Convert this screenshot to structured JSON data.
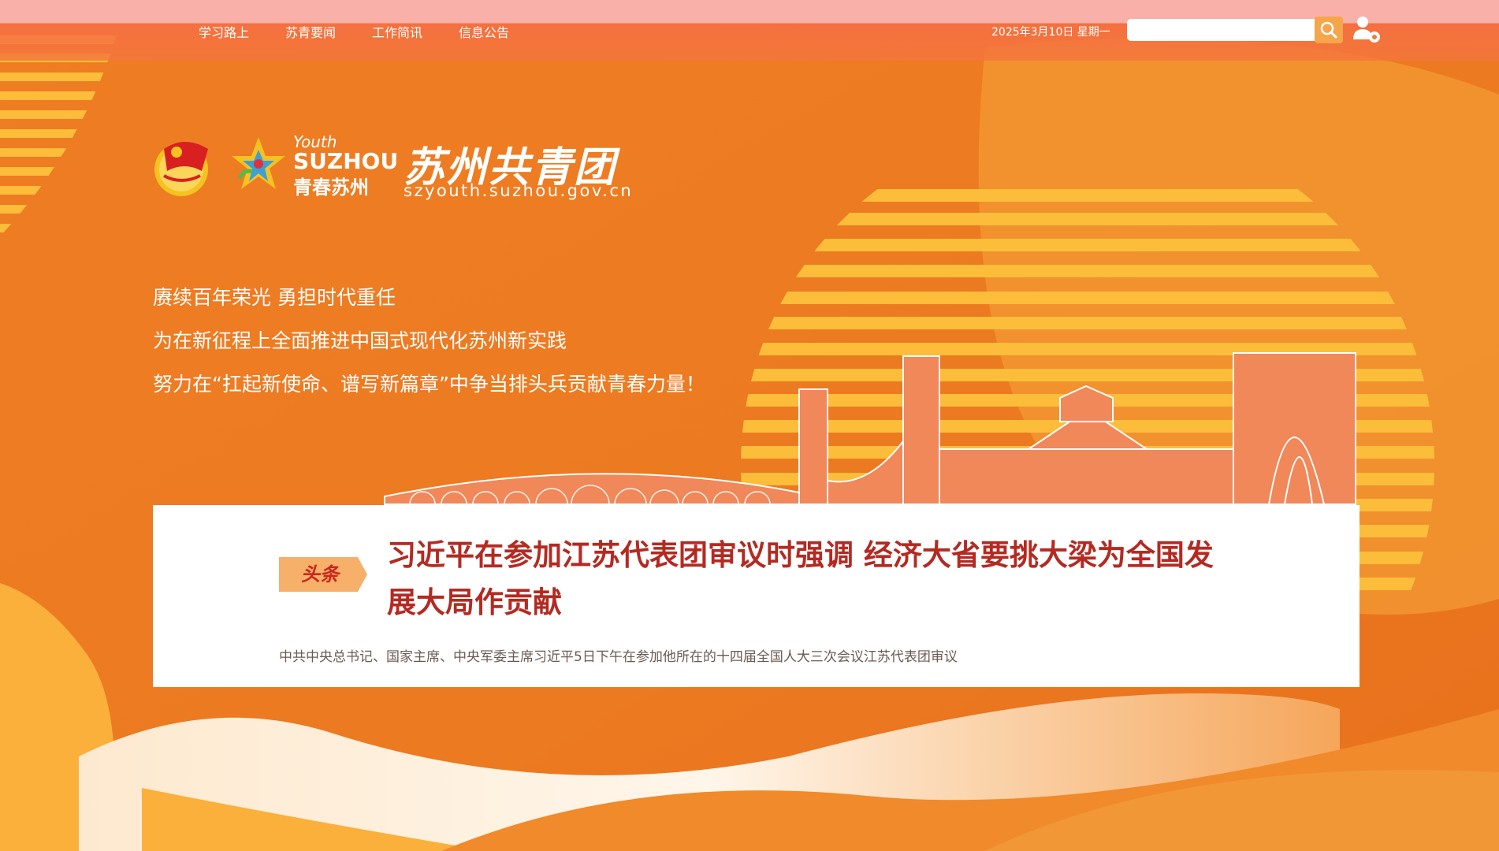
{
  "nav": {
    "items": [
      {
        "label": "学习路上"
      },
      {
        "label": "苏青要闻"
      },
      {
        "label": "工作简讯"
      },
      {
        "label": "信息公告"
      }
    ]
  },
  "header": {
    "date": "2025年3月10日 星期一",
    "search_placeholder": "",
    "search_icon": "search-icon",
    "user_icon": "user-settings-icon"
  },
  "brand": {
    "youth": "Youth",
    "suzhou": "SUZHOU",
    "qingchun": "青春苏州",
    "title": "苏州共青团",
    "url": "szyouth.suzhou.gov.cn"
  },
  "slogans": [
    "赓续百年荣光 勇担时代重任",
    "为在新征程上全面推进中国式现代化苏州新实践",
    "努力在“扛起新使命、谱写新篇章”中争当排头兵贡献青春力量！"
  ],
  "headline": {
    "tag": "头条",
    "title": "习近平在参加江苏代表团审议时强调 经济大省要挑大梁为全国发展大局作贡献",
    "summary": "中共中央总书记、国家主席、中央军委主席习近平5日下午在参加他所在的十四届全国人大三次会议江苏代表团审议"
  },
  "colors": {
    "primary_orange": "#ea7420",
    "stripe_yellow": "#fbbd3a",
    "headline_red": "#b42a22",
    "tag_bg": "#f7b06a"
  }
}
